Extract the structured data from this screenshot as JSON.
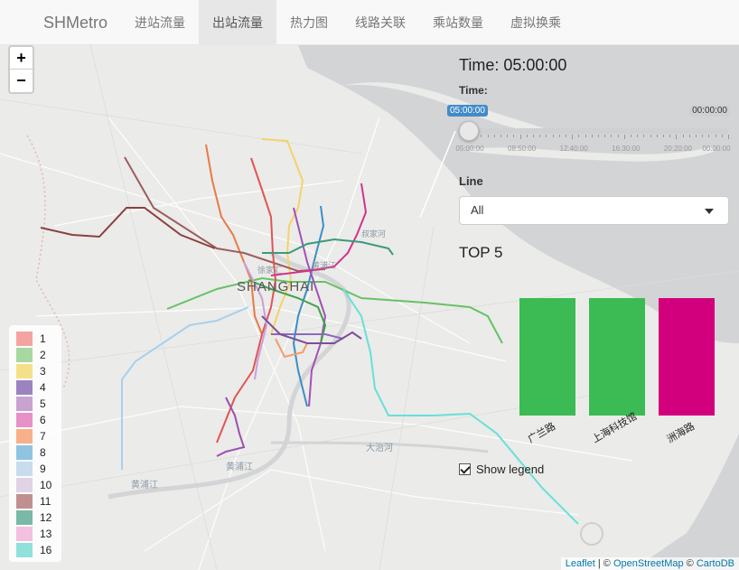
{
  "nav": {
    "brand": "SHMetro",
    "items": [
      {
        "label": "进站流量",
        "active": false
      },
      {
        "label": "出站流量",
        "active": true
      },
      {
        "label": "热力图",
        "active": false
      },
      {
        "label": "线路关联",
        "active": false
      },
      {
        "label": "乘站数量",
        "active": false
      },
      {
        "label": "虚拟换乘",
        "active": false
      }
    ]
  },
  "zoom": {
    "in": "+",
    "out": "−"
  },
  "map": {
    "city_label": "SHANGHAI",
    "place_labels": [
      "大治河",
      "黄浦江",
      "黄浦江",
      "徐家汇",
      "黄浦江",
      "叔家河"
    ]
  },
  "panel": {
    "time_title": "Time: 05:00:00",
    "time_label": "Time:",
    "slider": {
      "from": "05:00:00",
      "to": "00:00:00",
      "value_fraction": 0,
      "tick_labels": [
        "05:00:00",
        "08:50:00",
        "12:40:00",
        "16:30:00",
        "20:20:00",
        "00:00:00"
      ]
    },
    "line_label": "Line",
    "line_select": "All",
    "top_title": "TOP 5",
    "show_legend": "Show legend"
  },
  "chart_data": {
    "type": "bar",
    "title": "TOP 5",
    "categories": [
      "广兰路",
      "上海科技馆",
      "洲海路"
    ],
    "values": [
      1,
      1,
      1
    ],
    "colors": [
      "#3cba54",
      "#3cba54",
      "#d3007d"
    ]
  },
  "legend": {
    "items": [
      {
        "label": "1",
        "color": "#f4a3a0"
      },
      {
        "label": "2",
        "color": "#a8d8a0"
      },
      {
        "label": "3",
        "color": "#f5e08a"
      },
      {
        "label": "4",
        "color": "#9c83c0"
      },
      {
        "label": "5",
        "color": "#c8a3d0"
      },
      {
        "label": "6",
        "color": "#e890c8"
      },
      {
        "label": "7",
        "color": "#f7b08a"
      },
      {
        "label": "8",
        "color": "#8fc4e0"
      },
      {
        "label": "9",
        "color": "#c7ddee"
      },
      {
        "label": "10",
        "color": "#e2d2e6"
      },
      {
        "label": "11",
        "color": "#c09090"
      },
      {
        "label": "12",
        "color": "#7ab8a8"
      },
      {
        "label": "13",
        "color": "#f3c0e0"
      },
      {
        "label": "16",
        "color": "#90e0dc"
      }
    ]
  },
  "attribution": {
    "leaflet": "Leaflet",
    "osm": "OpenStreetMap",
    "carto": "CartoDB",
    "sep1": " | © ",
    "sep2": " © "
  }
}
